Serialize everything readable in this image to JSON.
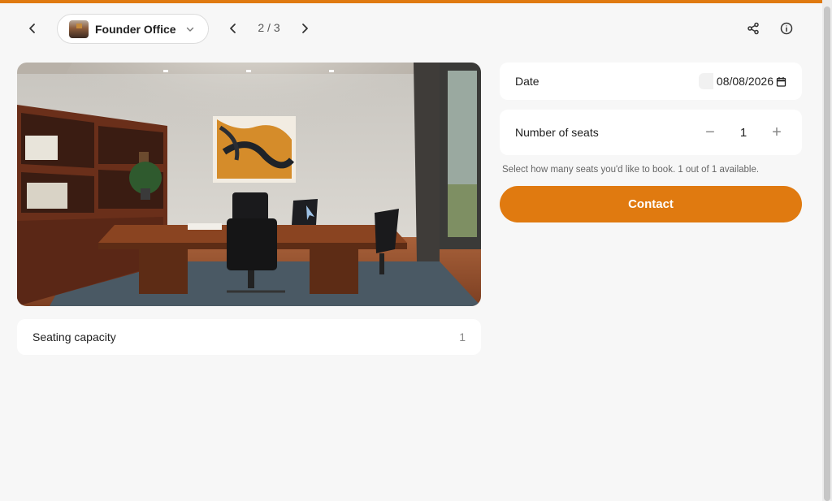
{
  "header": {
    "room_name": "Founder Office",
    "pager": "2 / 3"
  },
  "listing": {
    "photo_alt": "Founder Office",
    "capacity_label": "Seating capacity",
    "capacity_value": "1"
  },
  "booking": {
    "date_label": "Date",
    "date_value": "08/08/2026",
    "seats_label": "Number of seats",
    "seats_value": "1",
    "decrement_symbol": "−",
    "increment_symbol": "+",
    "helper_text": "Select how many seats you'd like to book. 1 out of 1 available.",
    "contact_label": "Contact"
  },
  "colors": {
    "accent": "#e07a10",
    "background": "#f7f7f7",
    "card": "#ffffff"
  },
  "icons": [
    "back-icon",
    "chevron-down-icon",
    "chevron-left-icon",
    "chevron-right-icon",
    "share-icon",
    "info-icon",
    "calendar-icon"
  ]
}
